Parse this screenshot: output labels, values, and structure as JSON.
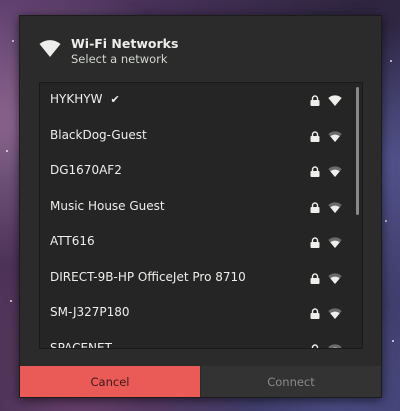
{
  "header": {
    "title": "Wi-Fi Networks",
    "subtitle": "Select a network"
  },
  "networks": [
    {
      "name": "HYKHYW",
      "connected": true,
      "secured": true,
      "signal": "full"
    },
    {
      "name": "BlackDog-Guest",
      "connected": false,
      "secured": true,
      "signal": "good"
    },
    {
      "name": "DG1670AF2",
      "connected": false,
      "secured": true,
      "signal": "good"
    },
    {
      "name": "Music House Guest",
      "connected": false,
      "secured": true,
      "signal": "good"
    },
    {
      "name": "ATT616",
      "connected": false,
      "secured": true,
      "signal": "good"
    },
    {
      "name": "DIRECT-9B-HP OfficeJet Pro 8710",
      "connected": false,
      "secured": true,
      "signal": "good"
    },
    {
      "name": "SM-J327P180",
      "connected": false,
      "secured": true,
      "signal": "good"
    },
    {
      "name": "SPACENET",
      "connected": false,
      "secured": true,
      "signal": "good"
    }
  ],
  "check_mark": "✔",
  "buttons": {
    "cancel": "Cancel",
    "connect": "Connect"
  },
  "colors": {
    "dialog_bg": "#2b2b2b",
    "cancel_bg": "#ea5a56",
    "connect_bg": "#333333",
    "text": "#eeeeec"
  },
  "icons": {
    "header": "wifi-icon",
    "lock": "lock-icon",
    "signal": "wifi-signal-icon",
    "connected": "checkmark-icon"
  }
}
